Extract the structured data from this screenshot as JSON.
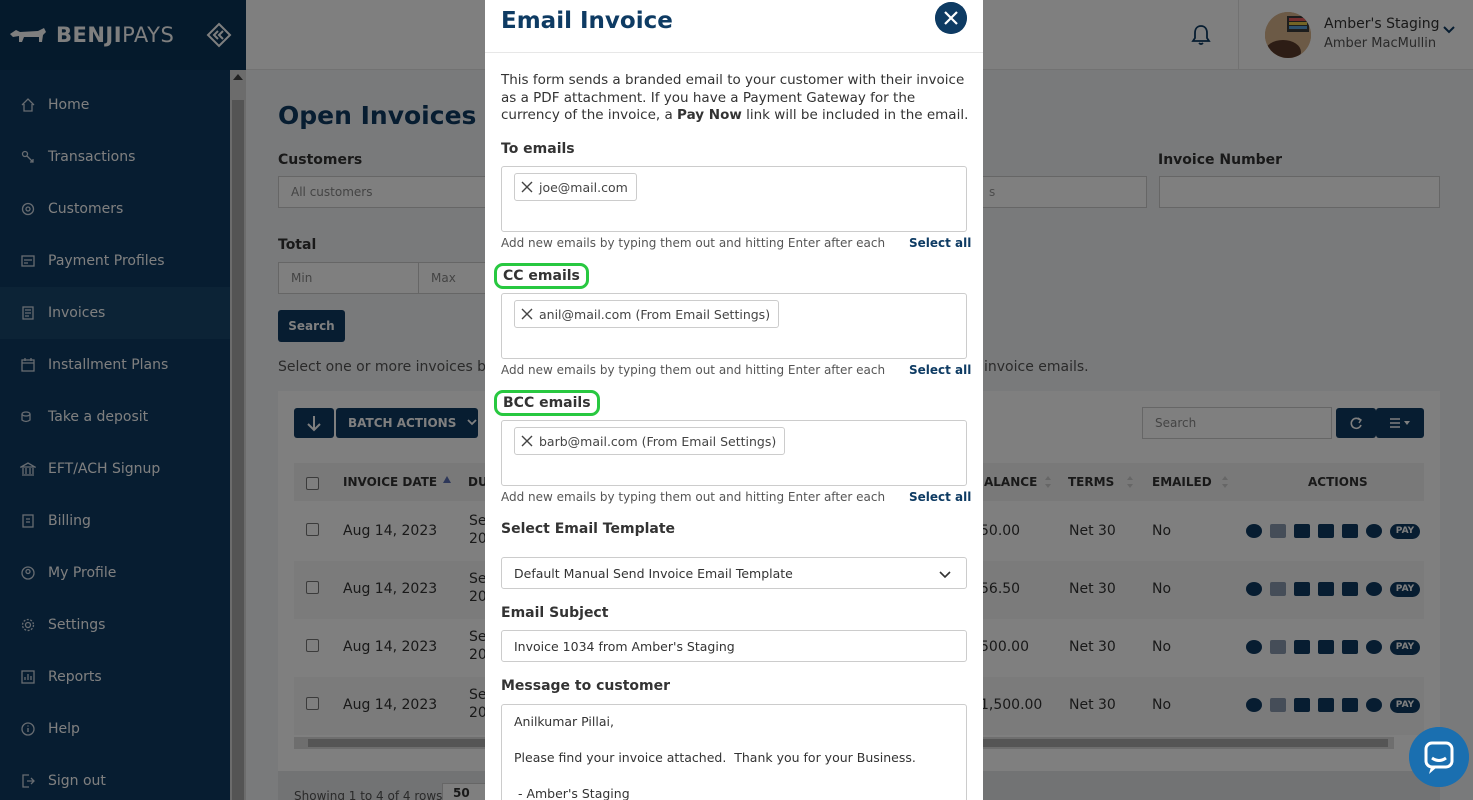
{
  "brand": {
    "name_bold": "BENJI",
    "name_light": "PAYS"
  },
  "sidebar": {
    "items": [
      {
        "label": "Home",
        "icon": "home-icon"
      },
      {
        "label": "Transactions",
        "icon": "transactions-icon"
      },
      {
        "label": "Customers",
        "icon": "customers-icon"
      },
      {
        "label": "Payment Profiles",
        "icon": "payment-profiles-icon"
      },
      {
        "label": "Invoices",
        "icon": "invoices-icon",
        "active": true
      },
      {
        "label": "Installment Plans",
        "icon": "calendar-icon"
      },
      {
        "label": "Take a deposit",
        "icon": "deposit-icon"
      },
      {
        "label": "EFT/ACH Signup",
        "icon": "bank-icon"
      },
      {
        "label": "Billing",
        "icon": "billing-icon"
      },
      {
        "label": "My Profile",
        "icon": "profile-icon"
      },
      {
        "label": "Settings",
        "icon": "gear-icon"
      },
      {
        "label": "Reports",
        "icon": "reports-icon"
      },
      {
        "label": "Help",
        "icon": "info-icon"
      },
      {
        "label": "Sign out",
        "icon": "sign-out-icon"
      }
    ]
  },
  "header": {
    "user_name": "Amber's Staging",
    "user_sub": "Amber MacMullin"
  },
  "main": {
    "title": "Open Invoices",
    "customers_label": "Customers",
    "customers_placeholder": "All customers",
    "invoice_number_label": "Invoice Number",
    "status_fragment": "s",
    "total_label": "Total",
    "min_placeholder": "Min",
    "max_placeholder": "Max",
    "search_button": "Search",
    "hint_left": "Select one or more invoices by",
    "hint_right": "invoice emails.",
    "batch_actions": "BATCH ACTIONS",
    "table_search_placeholder": "Search",
    "columns": [
      "INVOICE DATE",
      "DU",
      "ALANCE",
      "TERMS",
      "EMAILED",
      "ACTIONS"
    ],
    "rows": [
      {
        "date": "Aug 14, 2023",
        "due_a": "Se",
        "due_b": "20",
        "balance": "50.00",
        "terms": "Net 30",
        "emailed": "No"
      },
      {
        "date": "Aug 14, 2023",
        "due_a": "Se",
        "due_b": "20",
        "balance": "56.50",
        "terms": "Net 30",
        "emailed": "No"
      },
      {
        "date": "Aug 14, 2023",
        "due_a": "Se",
        "due_b": "20",
        "balance": "500.00",
        "terms": "Net 30",
        "emailed": "No"
      },
      {
        "date": "Aug 14, 2023",
        "due_a": "Se",
        "due_b": "20",
        "balance": "1,500.00",
        "terms": "Net 30",
        "emailed": "No"
      }
    ],
    "pay_label": "PAY",
    "footer_text": "Showing 1 to 4 of 4 rows",
    "page_size": "50"
  },
  "modal": {
    "title": "Email Invoice",
    "desc_1": "This form sends a branded email to your customer with their invoice as a PDF attachment. If you have a Payment Gateway for the currency of the invoice, a ",
    "desc_bold": "Pay Now",
    "desc_2": " link will be included in the email.",
    "to_label": "To emails",
    "to_chip": "joe@mail.com",
    "cc_label": "CC emails",
    "cc_chip": "anil@mail.com (From Email Settings)",
    "bcc_label": "BCC emails",
    "bcc_chip": "barb@mail.com (From Email Settings)",
    "help_text": "Add new emails by typing them out and hitting Enter after each",
    "select_all": "Select all",
    "template_label": "Select Email Template",
    "template_value": "Default Manual Send Invoice Email Template",
    "subject_label": "Email Subject",
    "subject_value": "Invoice 1034 from Amber's Staging",
    "message_label": "Message to customer",
    "message_lines": [
      "Anilkumar Pillai,",
      "",
      "Please find your invoice attached.  Thank you for your Business.",
      "",
      " - Amber's Staging"
    ]
  },
  "colors": {
    "brand_navy": "#0e3b63",
    "highlight_green": "#28c840"
  }
}
